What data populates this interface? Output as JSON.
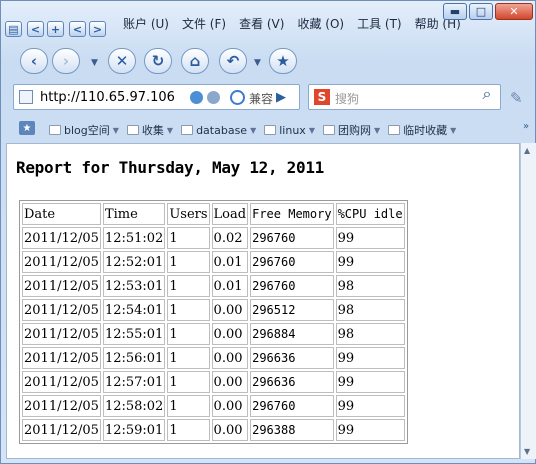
{
  "menu": [
    "账户 (U)",
    "文件 (F)",
    "查看 (V)",
    "收藏 (O)",
    "工具 (T)",
    "帮助 (H)"
  ],
  "address": {
    "url": "http://110.65.97.106",
    "compat_label": "兼容"
  },
  "search": {
    "placeholder": "搜狗",
    "engine_logo": "S"
  },
  "bookmarks": [
    "blog空间",
    "收集",
    "database",
    "linux",
    "团购网",
    "临时收藏"
  ],
  "report": {
    "title": "Report for Thursday, May 12, 2011",
    "headers": [
      "Date",
      "Time",
      "Users",
      "Load",
      "Free Memory",
      "%CPU idle"
    ],
    "rows": [
      [
        "2011/12/05",
        "12:51:02",
        "1",
        "0.02",
        "296760",
        "99"
      ],
      [
        "2011/12/05",
        "12:52:01",
        "1",
        "0.01",
        "296760",
        "99"
      ],
      [
        "2011/12/05",
        "12:53:01",
        "1",
        "0.01",
        "296760",
        "98"
      ],
      [
        "2011/12/05",
        "12:54:01",
        "1",
        "0.00",
        "296512",
        "98"
      ],
      [
        "2011/12/05",
        "12:55:01",
        "1",
        "0.00",
        "296884",
        "98"
      ],
      [
        "2011/12/05",
        "12:56:01",
        "1",
        "0.00",
        "296636",
        "99"
      ],
      [
        "2011/12/05",
        "12:57:01",
        "1",
        "0.00",
        "296636",
        "99"
      ],
      [
        "2011/12/05",
        "12:58:02",
        "1",
        "0.00",
        "296760",
        "99"
      ],
      [
        "2011/12/05",
        "12:59:01",
        "1",
        "0.00",
        "296388",
        "99"
      ]
    ]
  }
}
